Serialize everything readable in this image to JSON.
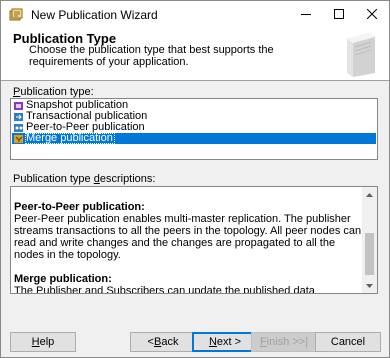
{
  "window": {
    "title": "New Publication Wizard",
    "icons": {
      "app": "wizard-app-icon",
      "minimize": "minimize-icon",
      "maximize": "maximize-icon",
      "close": "close-icon"
    }
  },
  "header": {
    "title": "Publication Type",
    "description": "Choose the publication type that best supports the requirements of your application.",
    "graphic": "wizard-page-graphic"
  },
  "publication_type": {
    "label_accel": "P",
    "label_rest": "ublication type:",
    "items": [
      {
        "label": "Snapshot publication",
        "icon": "snapshot-publication-icon",
        "selected": false
      },
      {
        "label": "Transactional publication",
        "icon": "transactional-publication-icon",
        "selected": false
      },
      {
        "label": "Peer-to-Peer publication",
        "icon": "peer-to-peer-publication-icon",
        "selected": false
      },
      {
        "label": "Merge publication",
        "icon": "merge-publication-icon",
        "selected": true
      }
    ]
  },
  "descriptions": {
    "label_pre": "Publication type ",
    "label_accel": "d",
    "label_rest": "escriptions:",
    "blocks": [
      {
        "heading": "Peer-to-Peer publication:",
        "body": "Peer-Peer publication enables multi-master replication. The publisher streams transactions to all the peers in the topology. All peer nodes can read and write changes and the changes are propagated to all the nodes in the topology."
      },
      {
        "heading": "Merge publication:",
        "body": "The Publisher and Subscribers can update the published data independently after the Subscribers receive an initial snapshot of the published data. Changes are merged periodically. Microsoft SQL Server Compact Edition can only subscribe to merge publications."
      }
    ]
  },
  "buttons": {
    "help": {
      "accel": "H",
      "rest": "elp"
    },
    "back": {
      "pre": "< ",
      "accel": "B",
      "rest": "ack"
    },
    "next": {
      "accel": "N",
      "rest": "ext >"
    },
    "finish": {
      "accel": "F",
      "rest": "inish >>|"
    },
    "cancel": "Cancel"
  },
  "colors": {
    "selection": "#0078d7",
    "window_bg": "#f0f0f0"
  }
}
